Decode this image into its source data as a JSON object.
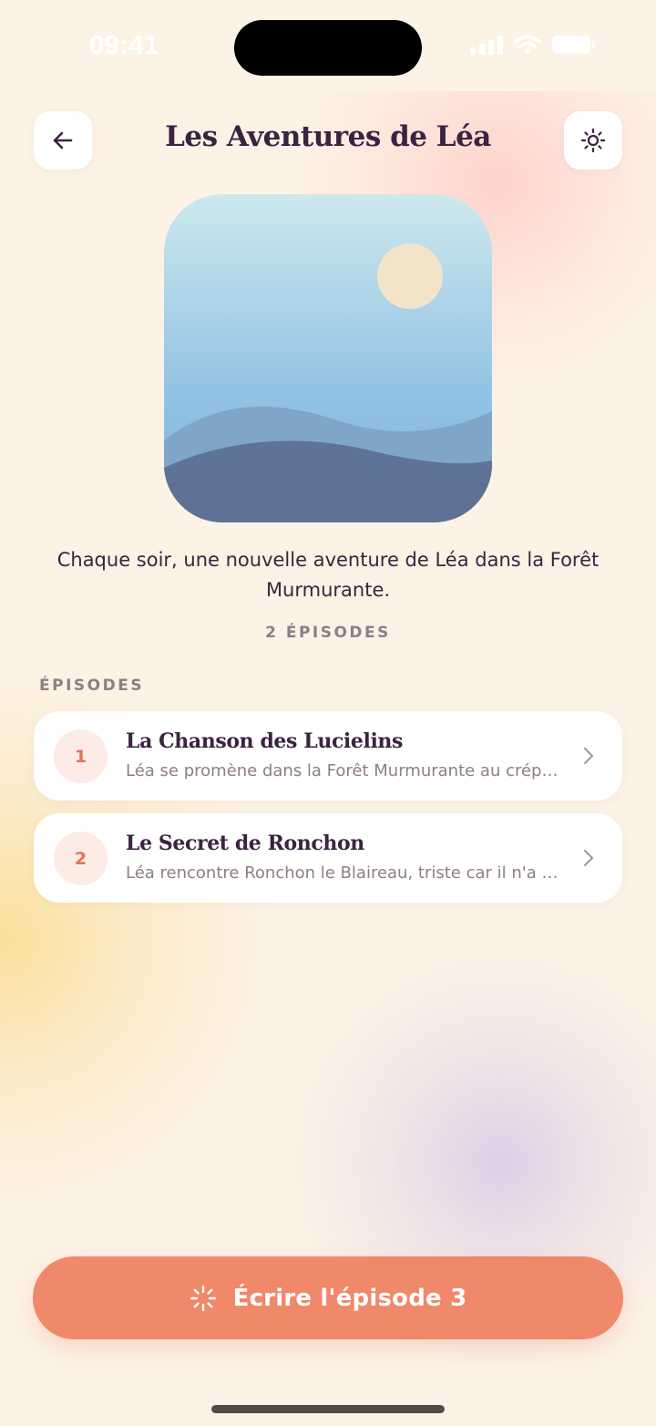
{
  "status_bar": {
    "time": "09:41"
  },
  "header": {
    "title": "Les Aventures de Léa",
    "back_icon": "arrow-left-icon",
    "theme_icon": "sun-icon"
  },
  "series": {
    "description": "Chaque soir, une nouvelle aventure de Léa dans la Forêt Murmurante.",
    "episode_count": "2 ÉPISODES"
  },
  "episodes_section": {
    "label": "ÉPISODES",
    "items": [
      {
        "number": "1",
        "title": "La Chanson des Lucielins",
        "summary": "Léa se promène dans la Forêt Murmurante au crépu..."
      },
      {
        "number": "2",
        "title": "Le Secret de Ronchon",
        "summary": "Léa rencontre Ronchon le Blaireau, triste car il n'a p..."
      }
    ]
  },
  "cta": {
    "label": "Écrire l'épisode 3",
    "icon": "sparkle-icon"
  },
  "colors": {
    "background": "#fdf2e6",
    "text_primary": "#3b2340",
    "text_muted": "#8d7e86",
    "accent": "#f0886a",
    "badge_bg": "#fdece6",
    "badge_text": "#e0735a"
  }
}
